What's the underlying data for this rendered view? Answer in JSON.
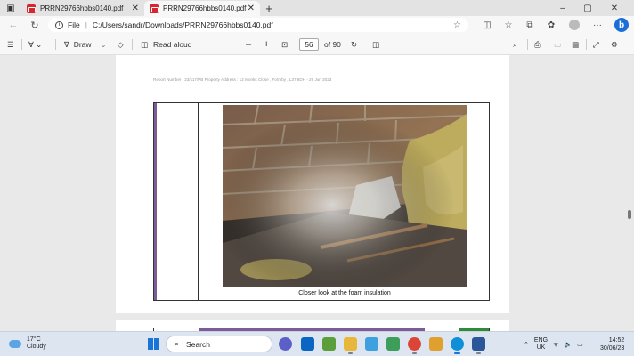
{
  "tabs": [
    {
      "label": "PRRN29766hbbs0140.pdf",
      "active": false
    },
    {
      "label": "PRRN29766hbbs0140.pdf",
      "active": true
    }
  ],
  "window": {
    "new_tab": "+",
    "minimize": "–",
    "maximize": "▢",
    "close": "✕"
  },
  "address": {
    "scheme_label": "File",
    "url": "C:/Users/sandr/Downloads/PRRN29766hbbs0140.pdf"
  },
  "toolbar": {
    "draw_label": "Draw",
    "read_aloud_label": "Read aloud",
    "zoom_out": "–",
    "zoom_in": "+",
    "current_page": "56",
    "page_total": "of 90"
  },
  "document": {
    "report_header": "Report Number : 23/117/PB    Property Address : 12 Monks Close , Formby , L37 6DH - 29 Jun 2023",
    "caption": "Closer look at the foam insulation"
  },
  "taskbar": {
    "weather_temp": "17°C",
    "weather_desc": "Cloudy",
    "search_label": "Search",
    "lang_line1": "ENG",
    "lang_line2": "UK",
    "time": "14:52",
    "date": "30/06/23"
  },
  "colors": {
    "accent_purple": "#7b5c99",
    "accent_green": "#2f8a3a",
    "pdf_red": "#d6262e",
    "edge_blue": "#1b6ed8"
  }
}
